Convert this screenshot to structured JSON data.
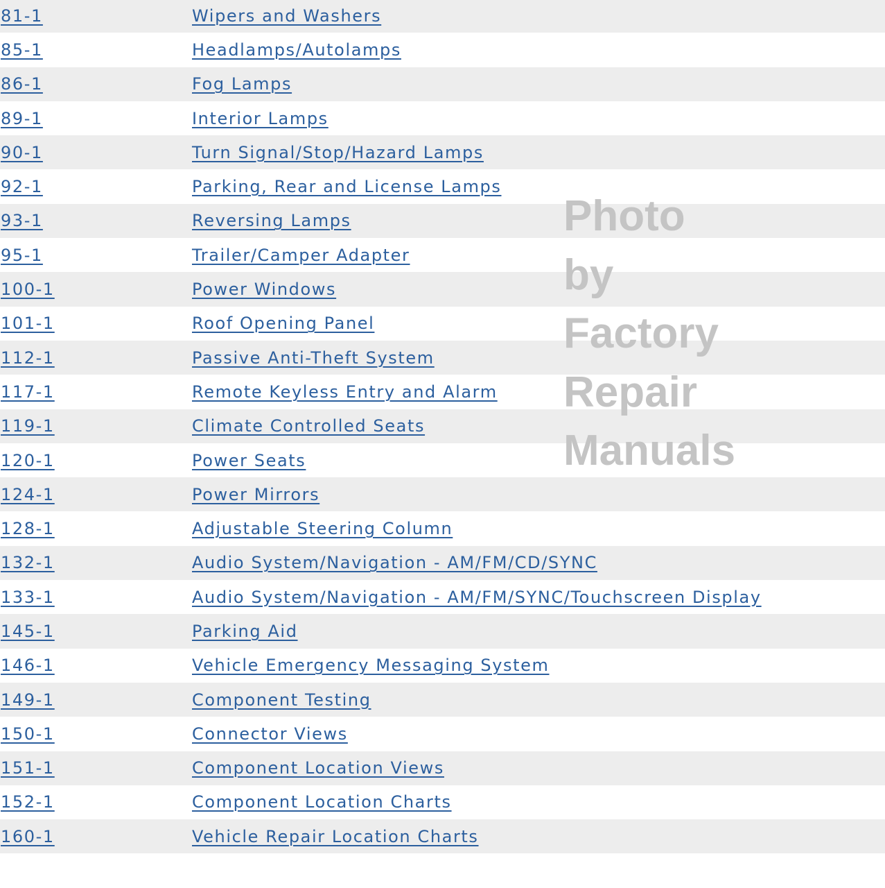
{
  "sections": [
    {
      "page": "81-1",
      "title": "Wipers and Washers"
    },
    {
      "page": "85-1",
      "title": "Headlamps/Autolamps"
    },
    {
      "page": "86-1",
      "title": "Fog Lamps"
    },
    {
      "page": "89-1",
      "title": "Interior Lamps"
    },
    {
      "page": "90-1",
      "title": "Turn Signal/Stop/Hazard Lamps"
    },
    {
      "page": "92-1",
      "title": "Parking, Rear and License Lamps"
    },
    {
      "page": "93-1",
      "title": "Reversing Lamps"
    },
    {
      "page": "95-1",
      "title": "Trailer/Camper Adapter"
    },
    {
      "page": "100-1",
      "title": "Power Windows"
    },
    {
      "page": "101-1",
      "title": "Roof Opening Panel"
    },
    {
      "page": "112-1",
      "title": "Passive Anti-Theft System"
    },
    {
      "page": "117-1",
      "title": "Remote Keyless Entry and Alarm"
    },
    {
      "page": "119-1",
      "title": "Climate Controlled Seats"
    },
    {
      "page": "120-1",
      "title": "Power Seats"
    },
    {
      "page": "124-1",
      "title": "Power Mirrors"
    },
    {
      "page": "128-1",
      "title": "Adjustable Steering Column"
    },
    {
      "page": "132-1",
      "title": "Audio System/Navigation - AM/FM/CD/SYNC"
    },
    {
      "page": "133-1",
      "title": "Audio System/Navigation - AM/FM/SYNC/Touchscreen Display"
    },
    {
      "page": "145-1",
      "title": "Parking Aid"
    },
    {
      "page": "146-1",
      "title": "Vehicle Emergency Messaging System"
    },
    {
      "page": "149-1",
      "title": "Component Testing"
    },
    {
      "page": "150-1",
      "title": "Connector Views"
    },
    {
      "page": "151-1",
      "title": "Component Location Views"
    },
    {
      "page": "152-1",
      "title": "Component Location Charts"
    },
    {
      "page": "160-1",
      "title": "Vehicle Repair Location Charts"
    }
  ],
  "watermark": [
    "Photo",
    "by",
    "Factory",
    "Repair",
    "Manuals"
  ],
  "colors": {
    "link": "#2c5f9e",
    "row_alt": "#ededed",
    "watermark": "#c4c4c4"
  }
}
